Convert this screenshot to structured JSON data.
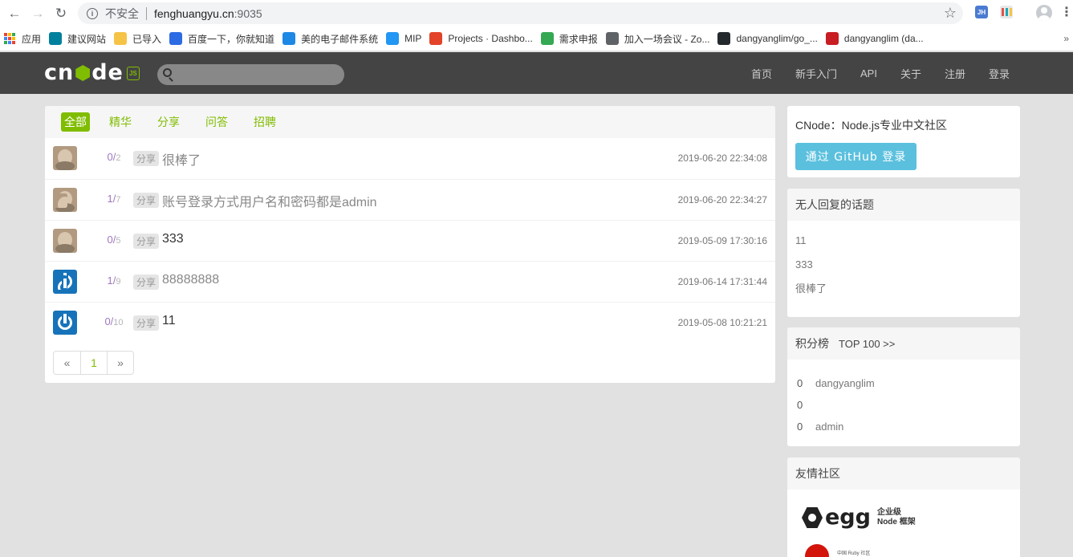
{
  "browser": {
    "insecure_label": "不安全",
    "url_host": "fenghuangyu.cn",
    "url_port": ":9035",
    "ext_jh_label": "JH",
    "bookmarks": [
      {
        "label": "应用",
        "icon": "apps-grid-icon"
      },
      {
        "label": "建议网站",
        "icon": "bing-icon",
        "color": "#00809d"
      },
      {
        "label": "已导入",
        "icon": "folder-icon",
        "color": "#f5c346"
      },
      {
        "label": "百度一下，你就知道",
        "icon": "baidu-paw-icon",
        "color": "#2d6be4"
      },
      {
        "label": "美的电子邮件系统",
        "icon": "mail-icon",
        "color": "#1e88e5"
      },
      {
        "label": "MIP",
        "icon": "mip-icon",
        "color": "#2196f3"
      },
      {
        "label": "Projects · Dashbo...",
        "icon": "gitlab-icon",
        "color": "#e24329"
      },
      {
        "label": "需求申报",
        "icon": "drive-icon",
        "color": "#34a853"
      },
      {
        "label": "加入一场会议 - Zo...",
        "icon": "globe-icon",
        "color": "#5f6368"
      },
      {
        "label": "dangyanglim/go_...",
        "icon": "github-icon",
        "color": "#24292e"
      },
      {
        "label": "dangyanglim (da...",
        "icon": "gitee-icon",
        "color": "#c71d23"
      }
    ],
    "bookmarks_more": "»"
  },
  "navbar": {
    "brand_left": "cn",
    "brand_right": "de",
    "brand_js": "JS",
    "search_placeholder": "",
    "links": [
      "首页",
      "新手入门",
      "API",
      "关于",
      "注册",
      "登录"
    ]
  },
  "topics": {
    "tabs": [
      {
        "label": "全部",
        "active": true
      },
      {
        "label": "精华",
        "active": false
      },
      {
        "label": "分享",
        "active": false
      },
      {
        "label": "问答",
        "active": false
      },
      {
        "label": "招聘",
        "active": false
      }
    ],
    "items": [
      {
        "avatar": "photo",
        "reply": "0",
        "visit": "2",
        "tag": "分享",
        "title": "很棒了",
        "visited": true,
        "last_avatar": null,
        "time": "2019-06-20 22:34:08"
      },
      {
        "avatar": "photo",
        "reply": "1",
        "visit": "7",
        "tag": "分享",
        "title": "账号登录方式用户名和密码都是admin",
        "visited": true,
        "last_avatar": "photo",
        "time": "2019-06-20 22:34:27"
      },
      {
        "avatar": "photo",
        "reply": "0",
        "visit": "5",
        "tag": "分享",
        "title": "333",
        "visited": false,
        "last_avatar": null,
        "time": "2019-05-09 17:30:16"
      },
      {
        "avatar": "power",
        "reply": "1",
        "visit": "9",
        "tag": "分享",
        "title": "88888888",
        "visited": true,
        "last_avatar": "power",
        "time": "2019-06-14 17:31:44"
      },
      {
        "avatar": "power",
        "reply": "0",
        "visit": "10",
        "tag": "分享",
        "title": "11",
        "visited": false,
        "last_avatar": null,
        "time": "2019-05-08 10:21:21"
      }
    ],
    "pager": {
      "prev": "«",
      "current": "1",
      "next": "»"
    }
  },
  "sidebar": {
    "intro": "CNode：Node.js专业中文社区",
    "github_login": "通过 GitHub 登录",
    "noreply_title": "无人回复的话题",
    "noreply_items": [
      "11",
      "333",
      "很棒了"
    ],
    "rank_title": "积分榜",
    "rank_link": "TOP 100 >>",
    "rank_items": [
      {
        "score": "0",
        "name": "dangyanglim"
      },
      {
        "score": "0",
        "name": ""
      },
      {
        "score": "0",
        "name": "admin"
      }
    ],
    "friends_title": "友情社区",
    "egg_word": "egg",
    "egg_sub1": "企业级",
    "egg_sub2": "Node 框架",
    "ruby_text": "中国 Ruby 社区"
  },
  "colors": {
    "accent": "#80bd01",
    "navbar": "#444444",
    "github_button": "#5bc0de",
    "reply_count": "#9e78c0"
  }
}
